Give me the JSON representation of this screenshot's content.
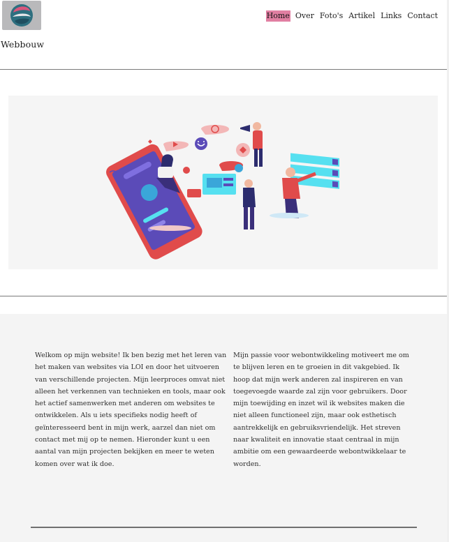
{
  "header": {
    "site_name": "Webbouw",
    "nav": [
      {
        "label": "Home",
        "active": true
      },
      {
        "label": "Over"
      },
      {
        "label": "Foto's"
      },
      {
        "label": "Artikel"
      },
      {
        "label": "Links"
      },
      {
        "label": "Contact"
      }
    ]
  },
  "hero": {
    "illustration": "social-media-web-development-illustration-icon"
  },
  "intro": {
    "left": "Welkom op mijn website! Ik ben bezig met het leren van het maken van websites via LOI en door het uitvoeren van verschillende projecten. Mijn leerproces omvat niet alleen het verkennen van technieken en tools, maar ook het actief samenwerken met anderen om websites te ontwikkelen. Als u iets specifieks nodig heeft of geïnteresseerd bent in mijn werk, aarzel dan niet om contact met mij op te nemen. Hieronder kunt u een aantal van mijn projecten bekijken en meer te weten komen over wat ik doe.",
    "right": "Mijn passie voor webontwikkeling motiveert me om te blijven leren en te groeien in dit vakgebied. Ik hoop dat mijn werk anderen zal inspireren en van toegevoegde waarde zal zijn voor gebruikers. Door mijn toewijding en inzet wil ik websites maken die niet alleen functioneel zijn, maar ook esthetisch aantrekkelijk en gebruiksvriendelijk. Het streven naar kwaliteit en innovatie staat centraal in mijn ambitie om een gewaardeerde webontwikkelaar te worden."
  },
  "colors": {
    "active_nav_bg": "#e17fa2",
    "content_bg": "#f4f4f4",
    "accent_red": "#e04b4b",
    "accent_purple": "#5b4bb8",
    "accent_cyan": "#56e0f0"
  }
}
